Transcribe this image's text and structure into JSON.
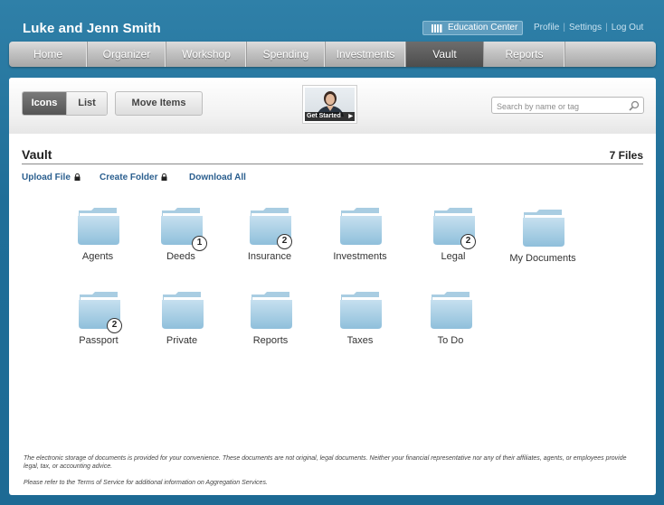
{
  "header": {
    "user_name": "Luke and Jenn Smith",
    "education_center": "Education Center",
    "links": [
      "Profile",
      "Settings",
      "Log Out"
    ]
  },
  "nav": {
    "items": [
      "Home",
      "Organizer",
      "Workshop",
      "Spending",
      "Investments",
      "Vault",
      "Reports"
    ],
    "active": "Vault"
  },
  "toolbar": {
    "icons_label": "Icons",
    "list_label": "List",
    "move_items_label": "Move Items",
    "video_caption": "Get Started",
    "search_placeholder": "Search by name or tag"
  },
  "vault": {
    "title": "Vault",
    "file_count": "7 Files",
    "upload_file": "Upload File",
    "create_folder": "Create Folder",
    "download_all": "Download All",
    "folders": [
      {
        "name": "Agents",
        "badge": ""
      },
      {
        "name": "Deeds",
        "badge": "1"
      },
      {
        "name": "Insurance",
        "badge": "2"
      },
      {
        "name": "Investments",
        "badge": ""
      },
      {
        "name": "Legal",
        "badge": "2"
      },
      {
        "name": "My Documents",
        "badge": ""
      },
      {
        "name": "Passport",
        "badge": "2"
      },
      {
        "name": "Private",
        "badge": ""
      },
      {
        "name": "Reports",
        "badge": ""
      },
      {
        "name": "Taxes",
        "badge": ""
      },
      {
        "name": "To Do",
        "badge": ""
      }
    ]
  },
  "footer": {
    "disclaimer": "The electronic storage of documents is provided for your convenience. These documents are not original, legal documents. Neither your financial representative nor any of their affiliates, agents, or employees provide legal, tax, or accounting advice.",
    "terms_note": "Please refer to the Terms of Service for additional information on Aggregation Services."
  },
  "colors": {
    "background": "#1f6e98",
    "link": "#2b5f8f",
    "folder": "#9fcbe3"
  }
}
